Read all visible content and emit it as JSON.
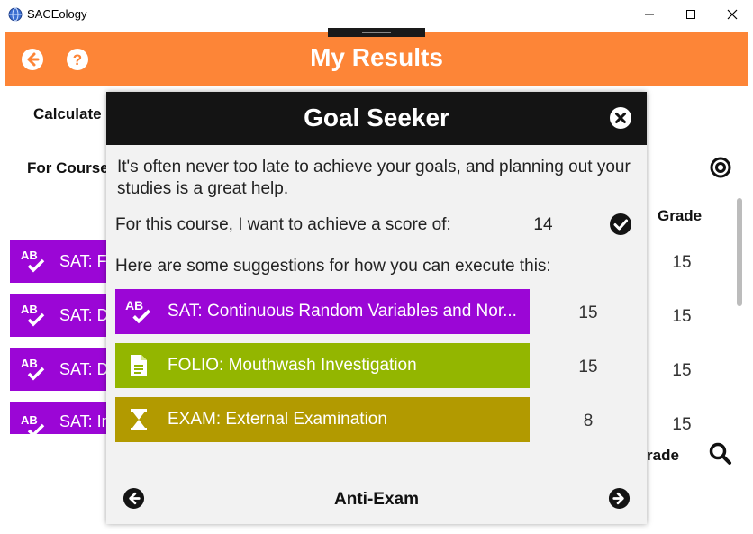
{
  "window": {
    "title": "SACEology"
  },
  "header": {
    "title": "My Results"
  },
  "background": {
    "calculate_label": "Calculate",
    "for_course_label": "For Course",
    "grade_header": "Grade",
    "grade_footer_label": "rade",
    "rows": [
      {
        "label": "SAT: F",
        "grade": "15"
      },
      {
        "label": "SAT: D",
        "grade": "15"
      },
      {
        "label": "SAT: D",
        "grade": "15"
      },
      {
        "label": "SAT: In",
        "grade": "15"
      }
    ]
  },
  "modal": {
    "title": "Goal Seeker",
    "intro": "It's often never too late to achieve your goals, and planning out your studies is a great help.",
    "target_label": "For this course, I want to achieve a score of:",
    "target_value": "14",
    "suggestions_label": "Here are some suggestions for how you can execute this:",
    "suggestions": [
      {
        "label": "SAT: Continuous Random Variables and Nor...",
        "score": "15",
        "icon": "ab-check-icon",
        "color": "#9b06d6"
      },
      {
        "label": "FOLIO: Mouthwash Investigation",
        "score": "15",
        "icon": "document-icon",
        "color": "#93b600"
      },
      {
        "label": "EXAM: External Examination",
        "score": "8",
        "icon": "hourglass-icon",
        "color": "#b29a00"
      }
    ],
    "footer_title": "Anti-Exam"
  }
}
